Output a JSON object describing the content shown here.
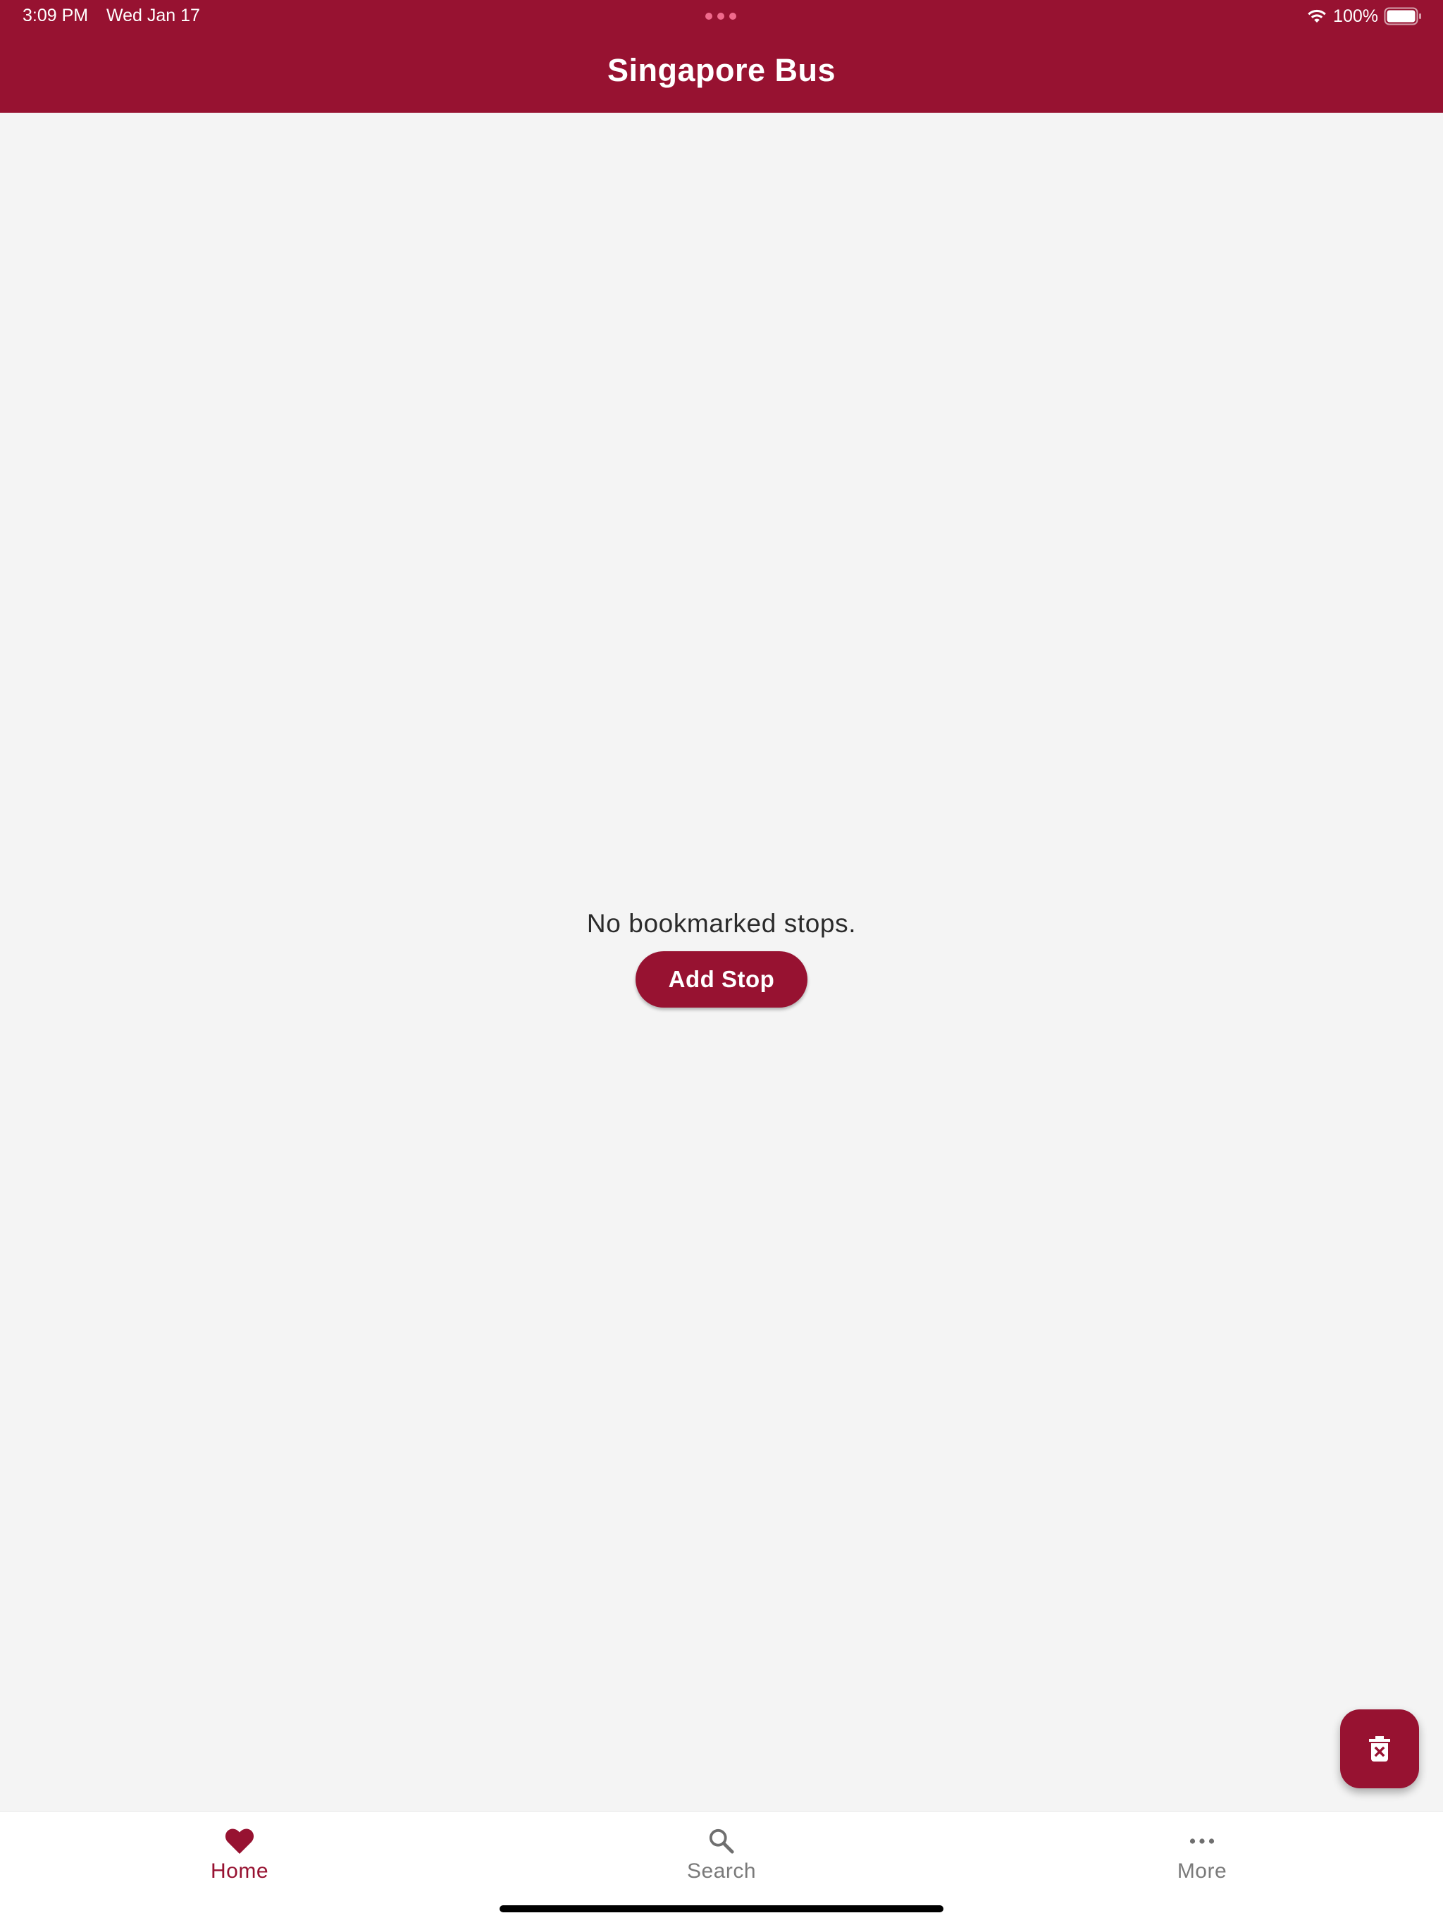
{
  "status_bar": {
    "time": "3:09 PM",
    "date": "Wed Jan 17",
    "battery": "100%",
    "icons": [
      "wifi-icon",
      "battery-icon",
      "multitask-dots-icon"
    ]
  },
  "header": {
    "title": "Singapore Bus"
  },
  "empty_state": {
    "message": "No bookmarked stops.",
    "button_label": "Add Stop"
  },
  "fab": {
    "icon": "delete-icon"
  },
  "tabs": [
    {
      "label": "Home",
      "icon": "heart-icon",
      "active": true
    },
    {
      "label": "Search",
      "icon": "search-icon",
      "active": false
    },
    {
      "label": "More",
      "icon": "more-icon",
      "active": false
    }
  ],
  "colors": {
    "brand": "#971231",
    "background": "#f4f4f4",
    "tab_inactive": "#7a7a7a",
    "multitask_dots": "#f06a8c"
  }
}
